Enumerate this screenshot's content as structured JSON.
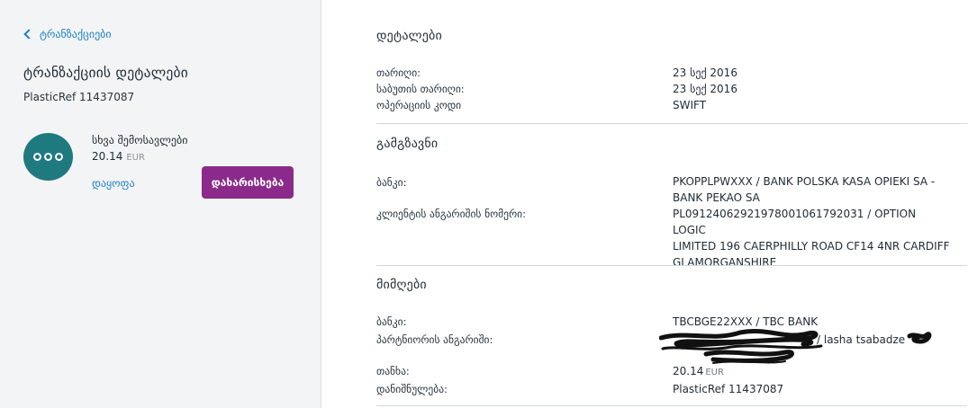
{
  "left": {
    "back_label": "ტრანზაქციები",
    "title": "ტრანზაქციის დეტალები",
    "reference": "PlasticRef 11437087",
    "category_icon": "more-dots-icon",
    "income_label": "სხვა შემოსავლები",
    "amount": "20.14",
    "currency": "EUR",
    "split_label": "დაყოფა",
    "categorize_label": "დახარისხება"
  },
  "details": {
    "heading": "დეტალები",
    "date_label": "თარიღი:",
    "date_value": "23 სექ 2016",
    "doc_date_label": "საბუთის თარიღი:",
    "doc_date_value": "23 სექ 2016",
    "operation_code_label": "ოპერაციის კოდი",
    "operation_code_value": "SWIFT"
  },
  "sender": {
    "heading": "გამგზავნი",
    "bank_label": "ბანკი:",
    "bank_value_line1": "PKOPPLPWXXX / BANK POLSKA KASA OPIEKI SA -",
    "bank_value_line2": "BANK PEKAO SA",
    "account_label": "კლიენტის ანგარიშის ნომერი:",
    "account_value_line1": "PL09124062921978001061792031 / OPTION LOGIC",
    "account_value_line2": "LIMITED 196 CAERPHILLY ROAD CF14 4NR CARDIFF",
    "account_value_line3": "GLAMORGANSHIRE"
  },
  "receiver": {
    "heading": "მიმღები",
    "bank_label": "ბანკი:",
    "bank_value": "TBCBGE22XXX / TBC BANK",
    "partner_account_label": "პარტნიორის ანგარიში:",
    "partner_account_visible": "/ lasha tsabadze",
    "amount_label": "თანხა:",
    "amount_value": "20.14",
    "amount_currency": "EUR",
    "purpose_label": "დანიშნულება:",
    "purpose_value": "PlasticRef 11437087"
  },
  "colors": {
    "accent_blue": "#1b7fc9",
    "button_purple": "#8c2a8b",
    "icon_teal": "#1f7a80",
    "panel_bg": "#f3f4f5"
  }
}
